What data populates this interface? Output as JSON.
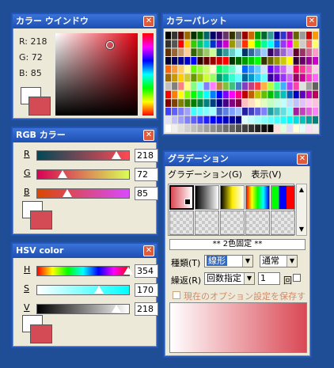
{
  "color_window": {
    "title": "カラー ウインドウ",
    "r": "R: 218",
    "g": "G:  72",
    "b": "B:  85"
  },
  "palette_window": {
    "title": "カラーパレット"
  },
  "rgb_window": {
    "title": "RGB カラー",
    "r_label": "R",
    "g_label": "G",
    "b_label": "B",
    "r_value": "218",
    "g_value": "72",
    "b_value": "85",
    "r_level": 218,
    "g_level": 72,
    "b_level": 85
  },
  "hsv_window": {
    "title": "HSV color",
    "h_label": "H",
    "s_label": "S",
    "v_label": "V",
    "h_value": "354",
    "s_value": "170",
    "v_value": "218",
    "h_level": 354,
    "s_level": 170,
    "v_level": 218
  },
  "gradient_window": {
    "title": "グラデーション",
    "menu_gradation": "グラデーション(G)",
    "menu_view": "表示(V)",
    "fixed_label": "** 2色固定 **",
    "type_label": "種類(T)",
    "type_value": "線形",
    "mode_value": "通常",
    "repeat_label": "繰返(R)",
    "repeat_value": "回数指定",
    "count_value": "1",
    "count_unit": "回",
    "save_option": "現在のオプション設定を保存する"
  },
  "colors": {
    "current": "#da4855",
    "title_bar": "#2456b8",
    "close": "#e05b3b"
  }
}
